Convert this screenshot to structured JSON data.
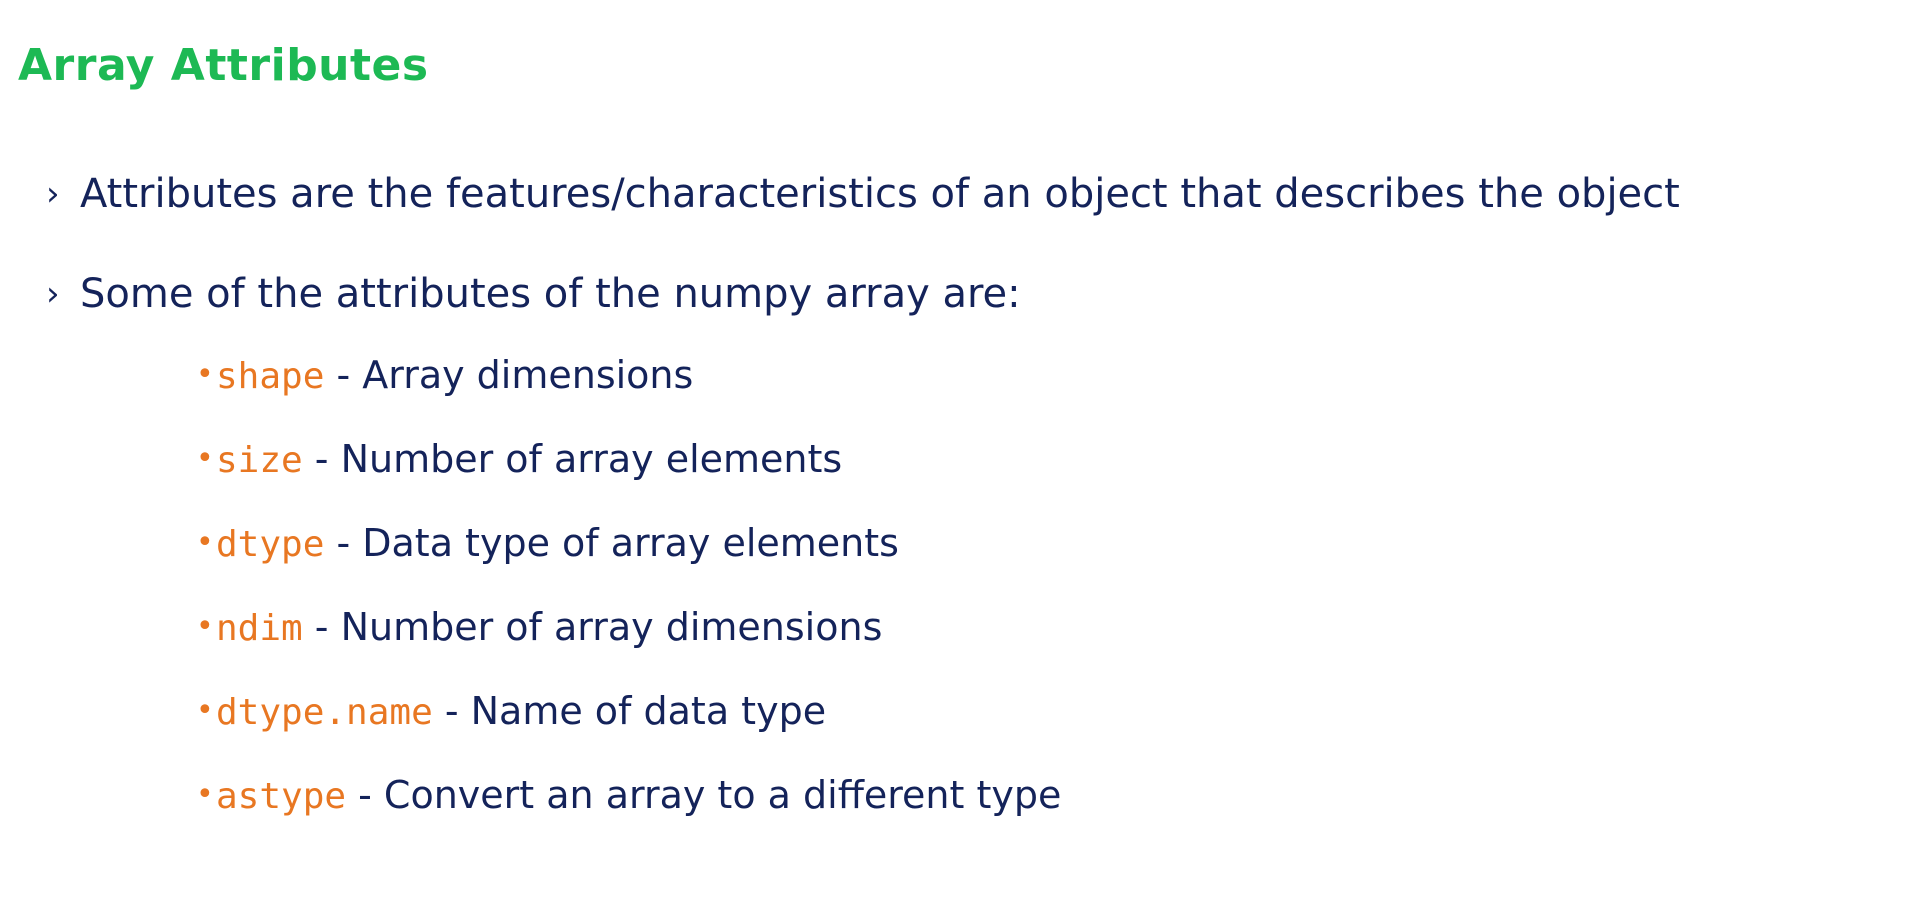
{
  "slide": {
    "title": "Array Attributes",
    "bullets": [
      {
        "marker": "›",
        "text": "Attributes are the features/characteristics of an object that describes the object"
      },
      {
        "marker": "›",
        "text": "Some of the attributes of the numpy array are:"
      }
    ],
    "attributes": [
      {
        "dot": "•",
        "code": "shape",
        "desc": " - Array dimensions"
      },
      {
        "dot": "•",
        "code": "size",
        "desc": " - Number of array elements"
      },
      {
        "dot": "•",
        "code": "dtype",
        "desc": " - Data type of array elements"
      },
      {
        "dot": "•",
        "code": "ndim",
        "desc": "  - Number of array dimensions"
      },
      {
        "dot": "•",
        "code": "dtype.name",
        "desc": "  - Name of data type"
      },
      {
        "dot": "•",
        "code": "astype",
        "desc": " - Convert an array to a different type"
      }
    ],
    "colors": {
      "title": "#1db954",
      "text": "#14235a",
      "code": "#e87722"
    }
  }
}
